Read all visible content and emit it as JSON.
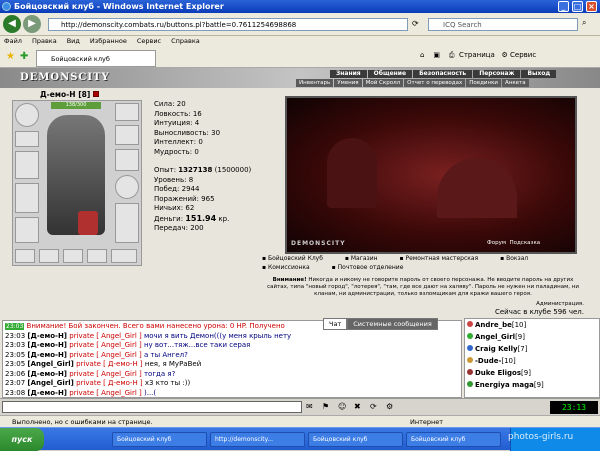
{
  "window": {
    "title": "Бойцовский клуб - Windows Internet Explorer"
  },
  "address": {
    "url": "http://demonscity.combats.ru/buttons.pl?battle=0.7611254698868",
    "search_placeholder": "ICQ Search"
  },
  "menu": [
    "Файл",
    "Правка",
    "Вид",
    "Избранное",
    "Сервис",
    "Справка"
  ],
  "tab": {
    "label": "Бойцовский клуб"
  },
  "toolbar": {
    "page": "Страница",
    "tools": "Сервис"
  },
  "game": {
    "logo": "DEMONSCITY",
    "top_menu": [
      "Знания",
      "Общение",
      "Безопасность",
      "Персонаж",
      "Выход"
    ],
    "sub_menu": [
      "Инвентарь",
      "Умения",
      "Мой Скролл",
      "Отчет о переводах",
      "Поединки",
      "Анкета"
    ],
    "character": {
      "name": "Д-емо-Н",
      "level": "[8]",
      "hp": "138/300"
    },
    "stats": [
      {
        "label": "Сила:",
        "value": "20"
      },
      {
        "label": "Ловкость:",
        "value": "16"
      },
      {
        "label": "Интуиция:",
        "value": "4"
      },
      {
        "label": "Выносливость:",
        "value": "30"
      },
      {
        "label": "Интеллект:",
        "value": "0"
      },
      {
        "label": "Мудрость:",
        "value": "0"
      }
    ],
    "stats2": [
      {
        "label": "Опыт:",
        "value": "1327138",
        "extra": "(1500000)"
      },
      {
        "label": "Уровень:",
        "value": "8"
      },
      {
        "label": "Побед:",
        "value": "2944"
      },
      {
        "label": "Поражений:",
        "value": "965"
      },
      {
        "label": "Ничьих:",
        "value": "62"
      },
      {
        "label": "Деньги:",
        "value": "151.94",
        "extra": "кр."
      },
      {
        "label": "Передач:",
        "value": "200"
      }
    ],
    "arena": {
      "logo": "DEMONSCITY",
      "links": [
        "Форум",
        "Подсказка"
      ]
    },
    "locations": [
      "Бойцовский Клуб",
      "Магазин",
      "Ремонтная мастерская",
      "Вокзал",
      "Комиссионка",
      "Почтовое отделение"
    ],
    "warning_title": "Внимание!",
    "warning_text": "Никогда и никому не говорите пароль от своего персонажа. Не вводите пароль на других сайтах, типа \"новый город\", \"лотерея\", \"там, где все дают на халяву\". Пароль не нужен ни паладинам, ни кланам, ни администрации, только взломщикам для кражи вашего героя.",
    "admin": "Администрация.",
    "online": "Сейчас в клубе 596 чел."
  },
  "chat": {
    "tabs": [
      "Чат",
      "Системные сообщения"
    ],
    "lines": [
      {
        "time": "23:03",
        "kind": "sys",
        "text": "Внимание! Бой закончен. Всего вами нанесено урона: 0 HP. Получено"
      },
      {
        "time": "23:03",
        "from": "[Д-емо-Н]",
        "to": "private [ Angel_Girl ]",
        "text": "мочи я вить Демон(((у меня крыль нету"
      },
      {
        "time": "23:03",
        "from": "[Д-емо-Н]",
        "to": "private [ Angel_Girl ]",
        "text": "ну вот...тяж...все таки серая"
      },
      {
        "time": "23:05",
        "from": "[Д-емо-Н]",
        "to": "private [ Angel_Girl ]",
        "text": "а ты Ангел?"
      },
      {
        "time": "23:05",
        "from": "[Angel_Girl]",
        "to": "private [ Д-емо-Н ]",
        "text": "нея, я МуРаВей"
      },
      {
        "time": "23:06",
        "from": "[Д-емо-Н]",
        "to": "private [ Angel_Girl ]",
        "text": "тогда я?"
      },
      {
        "time": "23:07",
        "from": "[Angel_Girl]",
        "to": "private [ Д-емо-Н ]",
        "text": "х3 кто ты :))"
      },
      {
        "time": "23:08",
        "from": "[Д-емо-Н]",
        "to": "private [ Angel_Girl ]",
        "text": ")...("
      }
    ]
  },
  "users": [
    {
      "name": "Andre_be",
      "level": "[10]"
    },
    {
      "name": "Angel_Girl",
      "level": "[9]"
    },
    {
      "name": "Craig Kelly",
      "level": "[7]"
    },
    {
      "name": "-Dude-",
      "level": "[10]"
    },
    {
      "name": "Duke Eligos",
      "level": "[9]"
    },
    {
      "name": "Energiya maga",
      "level": "[9]"
    }
  ],
  "clock": "23:13",
  "status": {
    "left": "Выполнено, но с ошибками на странице.",
    "right": "Интернет"
  },
  "taskbar": {
    "start": "пуск",
    "tasks": [
      "Бойцовский клуб",
      "http://demonscity...",
      "Бойцовский клуб",
      "Бойцовский клуб"
    ]
  },
  "watermark": "photos-girls.ru"
}
